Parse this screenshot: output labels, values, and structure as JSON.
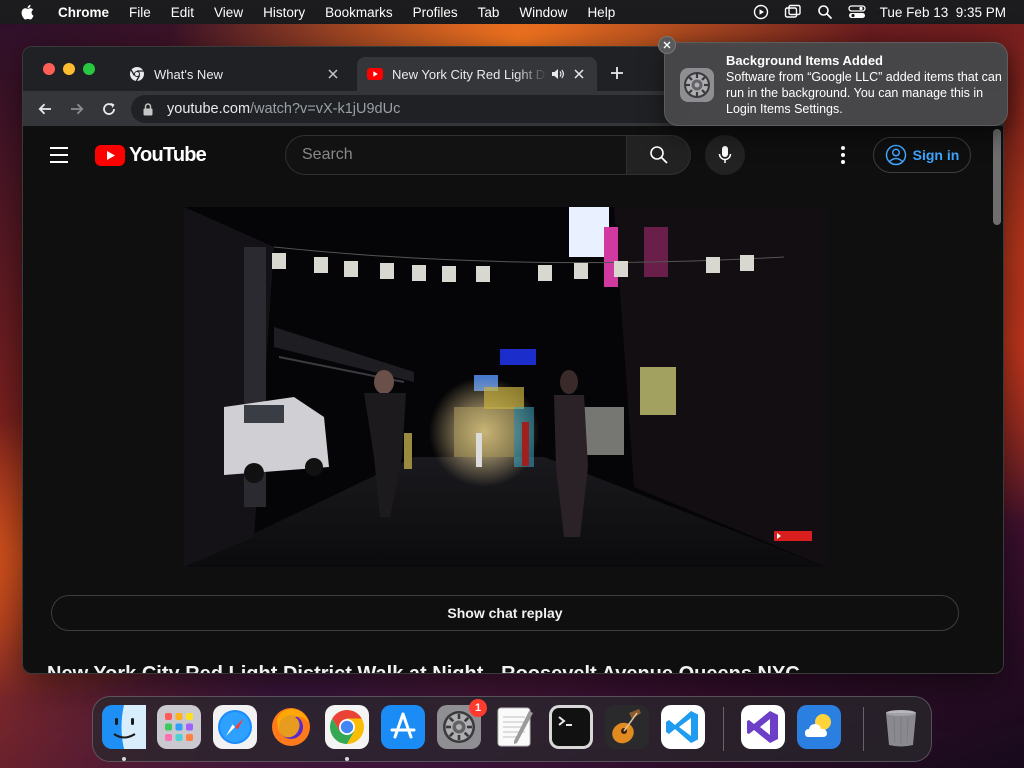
{
  "menubar": {
    "app_name": "Chrome",
    "items": [
      "File",
      "Edit",
      "View",
      "History",
      "Bookmarks",
      "Profiles",
      "Tab",
      "Window",
      "Help"
    ],
    "clock": "Tue Feb 13  9:35 PM"
  },
  "browser": {
    "tabs": [
      {
        "title": "What's New",
        "icon": "chrome-icon",
        "active": false
      },
      {
        "title": "New York City Red Light Di",
        "icon": "youtube-icon",
        "active": true,
        "audio": true
      }
    ],
    "url": {
      "host": "youtube.com",
      "path": "/watch?v=vX-k1jU9dUc"
    }
  },
  "youtube": {
    "logo_text": "YouTube",
    "search_placeholder": "Search",
    "sign_in_label": "Sign in",
    "chat_replay_label": "Show chat replay",
    "video_title": "New York City Red Light District Walk at Night - Roosevelt Avenue Queens NYC"
  },
  "notification": {
    "title": "Background Items Added",
    "body": "Software from “Google LLC” added items that can run in the background. You can manage this in Login Items Settings."
  },
  "dock": {
    "apps": [
      "Finder",
      "Launchpad",
      "Safari",
      "Firefox",
      "Google Chrome",
      "App Store",
      "System Settings",
      "TextEdit",
      "Terminal",
      "GarageBand",
      "Visual Studio Code",
      "Visual Studio",
      "Weather",
      "Trash"
    ],
    "system_settings_badge": "1"
  },
  "colors": {
    "youtube_red": "#ff0000",
    "link_blue": "#3ea6ff",
    "chrome_tab_active": "#35363a"
  }
}
